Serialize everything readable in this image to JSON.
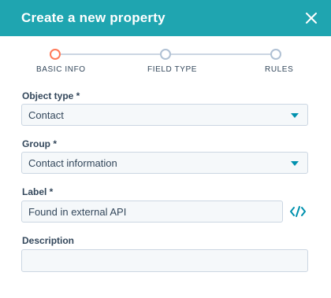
{
  "header": {
    "title": "Create a new property",
    "close_icon": "close-icon",
    "background": "#1fa5b0"
  },
  "stepper": {
    "steps": [
      {
        "label": "BASIC INFO",
        "active": true
      },
      {
        "label": "FIELD TYPE",
        "active": false
      },
      {
        "label": "RULES",
        "active": false
      }
    ]
  },
  "form": {
    "object_type": {
      "label": "Object type *",
      "value": "Contact"
    },
    "group": {
      "label": "Group *",
      "value": "Contact information"
    },
    "label": {
      "label": "Label *",
      "value": "Found in external API",
      "code_icon": "code-icon"
    },
    "description": {
      "label": "Description",
      "value": ""
    }
  },
  "colors": {
    "accent": "#0091ae",
    "active_step": "#ff7a59",
    "text": "#33475b"
  }
}
